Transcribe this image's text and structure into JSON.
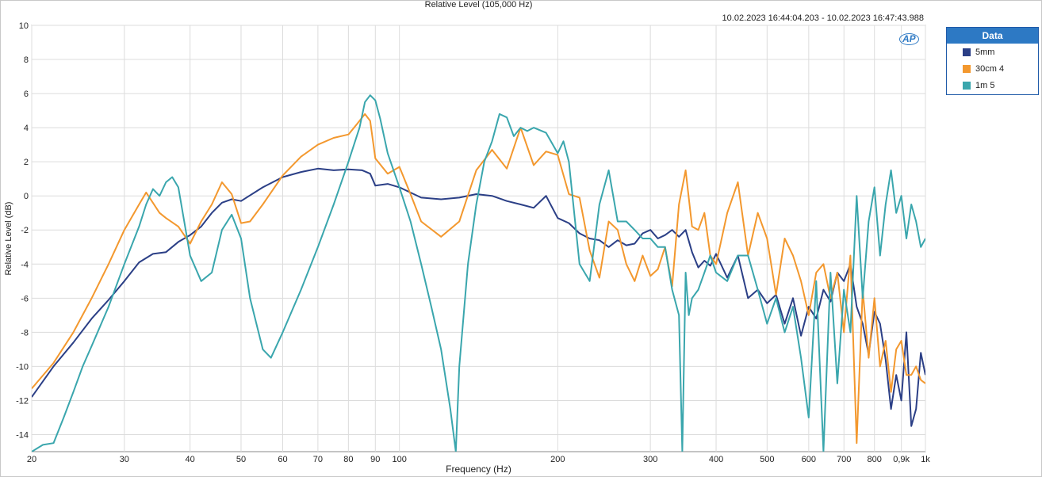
{
  "header": {
    "title": "Relative Level (105,000 Hz)",
    "timestamp": "10.02.2023 16:44:04.203 - 10.02.2023 16:47:43.988"
  },
  "logo_text": "AP",
  "legend": {
    "title": "Data",
    "items": [
      {
        "label": "5mm",
        "color": "#2b3f86"
      },
      {
        "label": "30cm 4",
        "color": "#f3982e"
      },
      {
        "label": "1m 5",
        "color": "#3aa6ad"
      }
    ]
  },
  "chart_data": {
    "type": "line",
    "xlabel": "Frequency (Hz)",
    "ylabel": "Relative Level (dB)",
    "x_scale": "log",
    "xlim": [
      20,
      1000
    ],
    "ylim": [
      -15,
      10
    ],
    "grid": true,
    "legend_position": "right",
    "x_ticks": [
      {
        "value": 20,
        "label": "20"
      },
      {
        "value": 30,
        "label": "30"
      },
      {
        "value": 40,
        "label": "40"
      },
      {
        "value": 50,
        "label": "50"
      },
      {
        "value": 60,
        "label": "60"
      },
      {
        "value": 70,
        "label": "70"
      },
      {
        "value": 80,
        "label": "80"
      },
      {
        "value": 90,
        "label": "90"
      },
      {
        "value": 100,
        "label": "100"
      },
      {
        "value": 200,
        "label": "200"
      },
      {
        "value": 300,
        "label": "300"
      },
      {
        "value": 400,
        "label": "400"
      },
      {
        "value": 500,
        "label": "500"
      },
      {
        "value": 600,
        "label": "600"
      },
      {
        "value": 700,
        "label": "700"
      },
      {
        "value": 800,
        "label": "800"
      },
      {
        "value": 900,
        "label": "0,9k"
      },
      {
        "value": 1000,
        "label": "1k"
      }
    ],
    "y_ticks": [
      10,
      8,
      6,
      4,
      2,
      0,
      -2,
      -4,
      -6,
      -8,
      -10,
      -12,
      -14
    ],
    "series": [
      {
        "name": "5mm",
        "color": "#2b3f86",
        "x": [
          20,
          22,
          24,
          26,
          28,
          30,
          32,
          34,
          36,
          38,
          40,
          42,
          44,
          46,
          48,
          50,
          55,
          60,
          65,
          70,
          75,
          80,
          85,
          88,
          90,
          95,
          100,
          110,
          120,
          130,
          140,
          150,
          160,
          170,
          180,
          190,
          200,
          210,
          220,
          230,
          240,
          250,
          260,
          270,
          280,
          290,
          300,
          310,
          320,
          330,
          340,
          350,
          360,
          370,
          380,
          390,
          400,
          420,
          440,
          460,
          480,
          500,
          520,
          540,
          560,
          580,
          600,
          620,
          640,
          660,
          680,
          700,
          720,
          740,
          760,
          780,
          800,
          820,
          840,
          860,
          880,
          900,
          920,
          940,
          960,
          980,
          1000
        ],
        "y": [
          -11.8,
          -10.0,
          -8.6,
          -7.2,
          -6.1,
          -5.0,
          -3.9,
          -3.4,
          -3.3,
          -2.7,
          -2.3,
          -1.8,
          -1.0,
          -0.4,
          -0.2,
          -0.3,
          0.5,
          1.1,
          1.4,
          1.6,
          1.5,
          1.55,
          1.5,
          1.3,
          0.6,
          0.7,
          0.5,
          -0.1,
          -0.2,
          -0.1,
          0.1,
          0.0,
          -0.3,
          -0.5,
          -0.7,
          0.0,
          -1.3,
          -1.6,
          -2.2,
          -2.5,
          -2.6,
          -3.0,
          -2.6,
          -2.9,
          -2.8,
          -2.2,
          -2.0,
          -2.5,
          -2.3,
          -2.0,
          -2.4,
          -2.0,
          -3.3,
          -4.2,
          -3.8,
          -4.1,
          -3.4,
          -4.8,
          -3.5,
          -6.0,
          -5.5,
          -6.3,
          -5.8,
          -7.5,
          -6.0,
          -8.2,
          -6.5,
          -7.2,
          -5.5,
          -6.2,
          -4.5,
          -5.0,
          -4.0,
          -6.5,
          -7.5,
          -9.3,
          -6.8,
          -7.5,
          -9.6,
          -12.5,
          -10.5,
          -12.0,
          -8.0,
          -13.5,
          -12.5,
          -9.2,
          -10.5
        ]
      },
      {
        "name": "30cm 4",
        "color": "#f3982e",
        "x": [
          20,
          22,
          24,
          26,
          28,
          30,
          32,
          33,
          35,
          36,
          38,
          40,
          42,
          44,
          46,
          48,
          50,
          52,
          55,
          60,
          65,
          70,
          75,
          80,
          83,
          86,
          88,
          90,
          95,
          100,
          105,
          110,
          120,
          130,
          140,
          150,
          160,
          170,
          180,
          190,
          200,
          210,
          220,
          230,
          240,
          250,
          260,
          270,
          280,
          290,
          300,
          310,
          320,
          330,
          340,
          350,
          360,
          370,
          380,
          390,
          400,
          420,
          440,
          460,
          480,
          500,
          520,
          540,
          560,
          580,
          600,
          620,
          640,
          660,
          680,
          700,
          720,
          740,
          760,
          780,
          800,
          820,
          840,
          860,
          880,
          900,
          920,
          940,
          960,
          980,
          1000
        ],
        "y": [
          -11.3,
          -9.8,
          -8.0,
          -6.0,
          -4.0,
          -2.0,
          -0.5,
          0.2,
          -1.0,
          -1.3,
          -1.8,
          -2.8,
          -1.5,
          -0.5,
          0.8,
          0.1,
          -1.6,
          -1.5,
          -0.5,
          1.2,
          2.3,
          3.0,
          3.4,
          3.6,
          4.2,
          4.8,
          4.4,
          2.2,
          1.3,
          1.7,
          0.1,
          -1.5,
          -2.4,
          -1.5,
          1.5,
          2.7,
          1.6,
          4.0,
          1.8,
          2.6,
          2.4,
          0.1,
          -0.1,
          -3.2,
          -4.8,
          -1.5,
          -2.0,
          -4.0,
          -5.0,
          -3.5,
          -4.7,
          -4.3,
          -3.0,
          -5.3,
          -0.5,
          1.5,
          -1.8,
          -2.0,
          -1.0,
          -3.5,
          -4.0,
          -1.0,
          0.8,
          -3.5,
          -1.0,
          -2.5,
          -5.8,
          -2.5,
          -3.5,
          -5.0,
          -7.0,
          -4.5,
          -4.0,
          -6.0,
          -4.5,
          -8.0,
          -3.5,
          -14.5,
          -5.5,
          -9.5,
          -6.0,
          -10.0,
          -8.5,
          -11.5,
          -9.0,
          -8.5,
          -10.5,
          -10.5,
          -10.0,
          -10.8,
          -11.0
        ]
      },
      {
        "name": "1m 5",
        "color": "#3aa6ad",
        "x": [
          20,
          21,
          22,
          23,
          24,
          25,
          26,
          28,
          30,
          32,
          33,
          34,
          35,
          36,
          37,
          38,
          40,
          42,
          44,
          46,
          48,
          50,
          52,
          55,
          57,
          60,
          65,
          70,
          75,
          80,
          84,
          86,
          88,
          90,
          92,
          95,
          100,
          105,
          110,
          115,
          120,
          125,
          128,
          130,
          135,
          140,
          145,
          150,
          155,
          160,
          165,
          170,
          175,
          180,
          190,
          200,
          205,
          210,
          220,
          230,
          240,
          250,
          260,
          270,
          280,
          290,
          300,
          310,
          320,
          330,
          340,
          345,
          350,
          355,
          360,
          370,
          380,
          390,
          400,
          420,
          440,
          460,
          480,
          500,
          520,
          540,
          560,
          580,
          600,
          620,
          640,
          660,
          680,
          700,
          720,
          740,
          760,
          780,
          800,
          820,
          840,
          860,
          880,
          900,
          920,
          940,
          960,
          980,
          1000
        ],
        "y": [
          -15.0,
          -14.6,
          -14.5,
          -13.0,
          -11.5,
          -10.0,
          -8.8,
          -6.5,
          -4.0,
          -1.8,
          -0.5,
          0.4,
          0.0,
          0.8,
          1.1,
          0.5,
          -3.5,
          -5.0,
          -4.5,
          -2.0,
          -1.1,
          -2.5,
          -6.0,
          -9.0,
          -9.5,
          -8.0,
          -5.5,
          -3.0,
          -0.5,
          2.0,
          4.0,
          5.5,
          5.9,
          5.6,
          4.5,
          2.5,
          0.5,
          -1.5,
          -4.0,
          -6.5,
          -9.0,
          -12.5,
          -15.0,
          -10.0,
          -4.0,
          -0.5,
          2.0,
          3.2,
          4.8,
          4.6,
          3.5,
          4.0,
          3.8,
          4.0,
          3.7,
          2.5,
          3.2,
          2.0,
          -4.0,
          -5.0,
          -0.5,
          1.5,
          -1.5,
          -1.5,
          -2.0,
          -2.5,
          -2.5,
          -3.0,
          -3.0,
          -5.5,
          -7.0,
          -15.0,
          -4.5,
          -7.0,
          -6.0,
          -5.5,
          -4.5,
          -3.5,
          -4.5,
          -5.0,
          -3.5,
          -3.5,
          -5.5,
          -7.5,
          -6.0,
          -8.0,
          -6.5,
          -9.5,
          -13.0,
          -5.0,
          -15.0,
          -4.5,
          -11.0,
          -5.5,
          -8.0,
          0.0,
          -6.0,
          -1.5,
          0.5,
          -3.5,
          -0.5,
          1.5,
          -1.0,
          0.0,
          -2.5,
          -0.5,
          -1.5,
          -3.0,
          -2.5
        ]
      }
    ]
  }
}
